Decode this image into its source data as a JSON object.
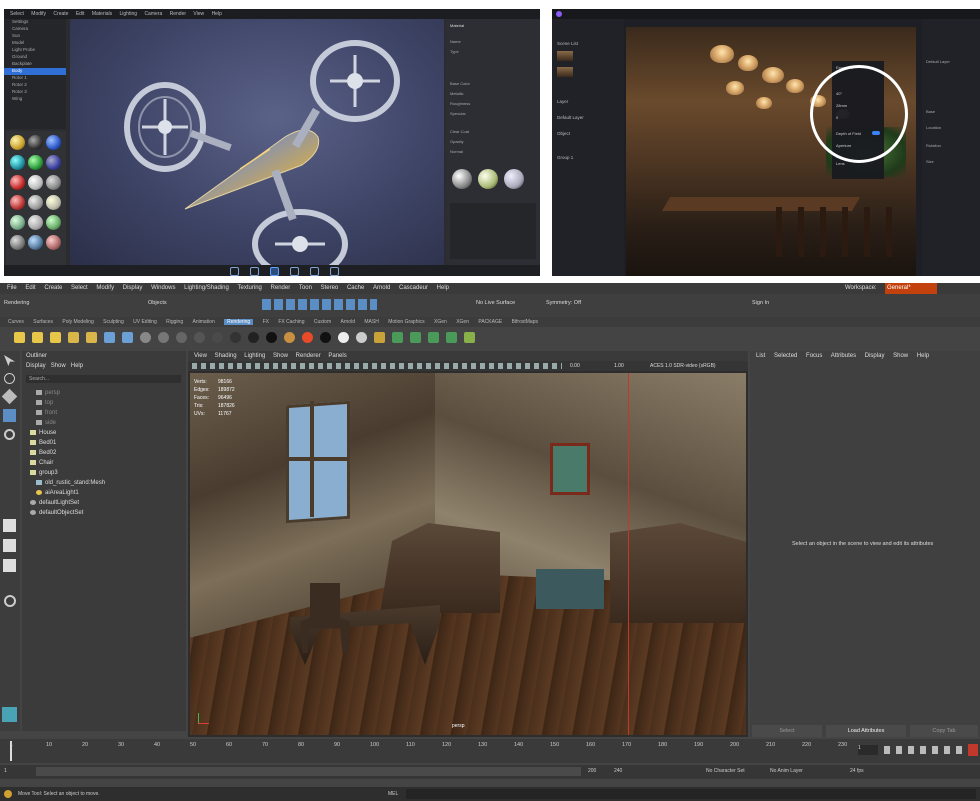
{
  "panel_a": {
    "menubar": [
      "Select",
      "Modify",
      "Create",
      "Edit",
      "Materials",
      "Lighting",
      "Camera",
      "Render",
      "View",
      "Help"
    ],
    "outliner_items": [
      "Settings",
      "Camera",
      "Sun",
      "Model",
      "Light Probe",
      "Ground",
      "Backplate",
      "Body",
      "Rotor 1",
      "Rotor 2",
      "Rotor 3",
      "Wing"
    ],
    "props_title": "Material",
    "props_rows": [
      "Name",
      "Type",
      "Base Color",
      "Metallic",
      "Roughness",
      "Specular",
      "Clear Coat",
      "Opacity",
      "Normal"
    ],
    "bottom_icons": [
      "render-icon",
      "camera-icon",
      "light-icon",
      "material-icon",
      "env-icon",
      "anim-icon"
    ]
  },
  "panel_b": {
    "nav_items": [
      "Scene List",
      "Layer",
      "Default Layer",
      "Object",
      "Group 1"
    ],
    "camera_panel": [
      "Exposure",
      "40°",
      "28mm",
      "0",
      "Depth of Field",
      "Aperture",
      "Lens",
      "Focus",
      "Distance",
      "Blur"
    ],
    "right_items": [
      "Default Layer",
      "Base",
      "Location",
      "Rotation",
      "Size"
    ]
  },
  "panel_c": {
    "menubar": [
      "File",
      "Edit",
      "Create",
      "Select",
      "Modify",
      "Display",
      "Windows",
      "Lighting/Shading",
      "Texturing",
      "Render",
      "Toon",
      "Stereo",
      "Cache",
      "Arnold",
      "Cascadeur",
      "Help"
    ],
    "workspace_label": "Workspace:",
    "workspace_value": "General*",
    "mode": "Rendering",
    "objects_label": "Objects",
    "live_surface": "No Live Surface",
    "symmetry": "Symmetry: Off",
    "sign_in": "Sign In",
    "shelf_tabs": [
      "Curves",
      "Surfaces",
      "Poly Modeling",
      "Sculpting",
      "UV Editing",
      "Rigging",
      "Animation",
      "Rendering",
      "FX",
      "FX Caching",
      "Custom",
      "Arnold",
      "MASH",
      "Motion Graphics",
      "XGen",
      "XGen",
      "PACKAGE",
      "BifrostMaps"
    ],
    "outliner_title": "Outliner",
    "outliner_menu": [
      "Display",
      "Show",
      "Help"
    ],
    "search_placeholder": "Search...",
    "outliner_items": [
      "persp",
      "top",
      "front",
      "side",
      "House",
      "Bed01",
      "Bed02",
      "Chair",
      "group3",
      "old_rustic_stand:Mesh",
      "aiAreaLight1",
      "defaultLightSet",
      "defaultObjectSet"
    ],
    "viewport_menu": [
      "View",
      "Shading",
      "Lighting",
      "Show",
      "Renderer",
      "Panels"
    ],
    "hud": [
      {
        "label": "Verts:",
        "value": "98166"
      },
      {
        "label": "Edges:",
        "value": "189872"
      },
      {
        "label": "Faces:",
        "value": "96496"
      },
      {
        "label": "Tris:",
        "value": "187826"
      },
      {
        "label": "UVs:",
        "value": "11767"
      }
    ],
    "colorspace": "ACES 1.0 SDR-video (sRGB)",
    "exposure_value": "0.00",
    "gamma_value": "1.00",
    "camera_label": "persp",
    "attr_menu": [
      "List",
      "Selected",
      "Focus",
      "Attributes",
      "Display",
      "Show",
      "Help"
    ],
    "attr_message": "Select an object in the scene to view and edit its attributes",
    "attr_buttons": [
      "Select",
      "Load Attributes",
      "Copy Tab"
    ],
    "timeline_ticks": [
      "1",
      "10",
      "20",
      "30",
      "40",
      "50",
      "60",
      "70",
      "80",
      "90",
      "100",
      "110",
      "120",
      "130",
      "140",
      "150",
      "160",
      "170",
      "180",
      "190",
      "200",
      "210",
      "220",
      "230"
    ],
    "current_frame": "1",
    "range_start": "1",
    "range_end": "200",
    "range_end2": "240",
    "no_character": "No Character Set",
    "no_anim_layer": "No Anim Layer",
    "fps": "24 fps",
    "help_line": "Move Tool: Select an object to move.",
    "mel_label": "MEL"
  },
  "colors": {
    "accent": "#5a8ec4",
    "maya_bg": "#444444",
    "viewport_bg": "#2d2d2d",
    "highlight": "#2f6fd6"
  }
}
